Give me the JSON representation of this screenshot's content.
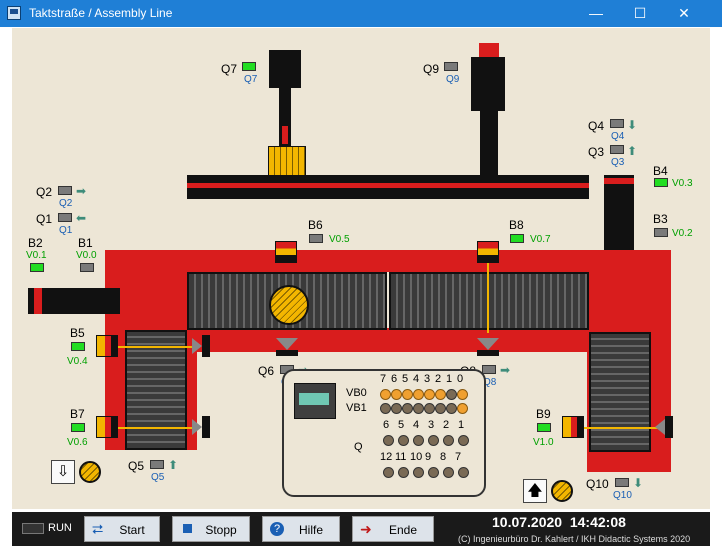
{
  "window": {
    "title": "Taktstraße / Assembly Line",
    "minimize": "—",
    "maximize": "☐",
    "close": "✕"
  },
  "sensors": {
    "Q7": {
      "label": "Q7",
      "sub": "Q7"
    },
    "Q9": {
      "label": "Q9",
      "sub": "Q9"
    },
    "Q4": {
      "label": "Q4",
      "sub": "Q4"
    },
    "Q3": {
      "label": "Q3",
      "sub": "Q3"
    },
    "B4": {
      "label": "B4",
      "sub": "V0.3"
    },
    "B3": {
      "label": "B3",
      "sub": "V0.2"
    },
    "Q2": {
      "label": "Q2",
      "sub": "Q2"
    },
    "Q1": {
      "label": "Q1",
      "sub": "Q1"
    },
    "B6": {
      "label": "B6",
      "sub": "V0.5"
    },
    "B8": {
      "label": "B8",
      "sub": "V0.7"
    },
    "B2": {
      "label": "B2",
      "sub": "V0.1"
    },
    "B1": {
      "label": "B1",
      "sub": "V0.0"
    },
    "B5": {
      "label": "B5",
      "sub": "V0.4"
    },
    "Q6": {
      "label": "Q6",
      "sub": "Q6"
    },
    "Q8": {
      "label": "Q8",
      "sub": "Q8"
    },
    "B7": {
      "label": "B7",
      "sub": "V0.6"
    },
    "B9": {
      "label": "B9",
      "sub": "V1.0"
    },
    "Q5": {
      "label": "Q5",
      "sub": "Q5"
    },
    "Q10": {
      "label": "Q10",
      "sub": "Q10"
    }
  },
  "panel": {
    "vb_header": [
      "7",
      "6",
      "5",
      "4",
      "3",
      "2",
      "1",
      "0"
    ],
    "vb0_label": "VB0",
    "vb1_label": "VB1",
    "q_label": "Q",
    "q_header1": [
      "6",
      "5",
      "4",
      "3",
      "2",
      "1"
    ],
    "q_header2": [
      "12",
      "11",
      "10",
      "9",
      "8",
      "7"
    ]
  },
  "toolbar": {
    "run_label": "RUN",
    "start_label": "Start",
    "stop_label": "Stopp",
    "help_label": "Hilfe",
    "exit_label": "Ende",
    "datetime": "10.07.2020  14:42:08",
    "copyright": "(C) Ingenieurbüro Dr. Kahlert / IKH Didactic Systems 2020"
  },
  "colors": {
    "machine_red": "#d91d1d",
    "led_on": "#22dd22",
    "led_off": "#7a7a7a",
    "workpiece": "#f3b600",
    "lamp_on": "#f0a030",
    "title_bar": "#1f7fd6"
  }
}
